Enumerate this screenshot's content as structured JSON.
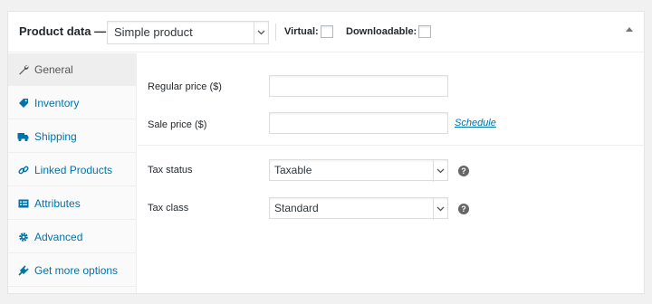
{
  "header": {
    "title": "Product data —",
    "product_type": "Simple product",
    "virtual_label": "Virtual:",
    "downloadable_label": "Downloadable:"
  },
  "tabs": [
    {
      "label": "General",
      "icon": "wrench-icon",
      "active": true
    },
    {
      "label": "Inventory",
      "icon": "tag-icon",
      "active": false
    },
    {
      "label": "Shipping",
      "icon": "truck-icon",
      "active": false
    },
    {
      "label": "Linked Products",
      "icon": "link-icon",
      "active": false
    },
    {
      "label": "Attributes",
      "icon": "list-icon",
      "active": false
    },
    {
      "label": "Advanced",
      "icon": "gear-icon",
      "active": false
    },
    {
      "label": "Get more options",
      "icon": "plugin-icon",
      "active": false
    }
  ],
  "general": {
    "regular_price_label": "Regular price ($)",
    "regular_price_value": "",
    "sale_price_label": "Sale price ($)",
    "sale_price_value": "",
    "schedule_link": "Schedule",
    "tax_status_label": "Tax status",
    "tax_status_value": "Taxable",
    "tax_class_label": "Tax class",
    "tax_class_value": "Standard",
    "help_glyph": "?"
  },
  "colors": {
    "link": "#0073aa",
    "active_tab_bg": "#eeeeee"
  }
}
